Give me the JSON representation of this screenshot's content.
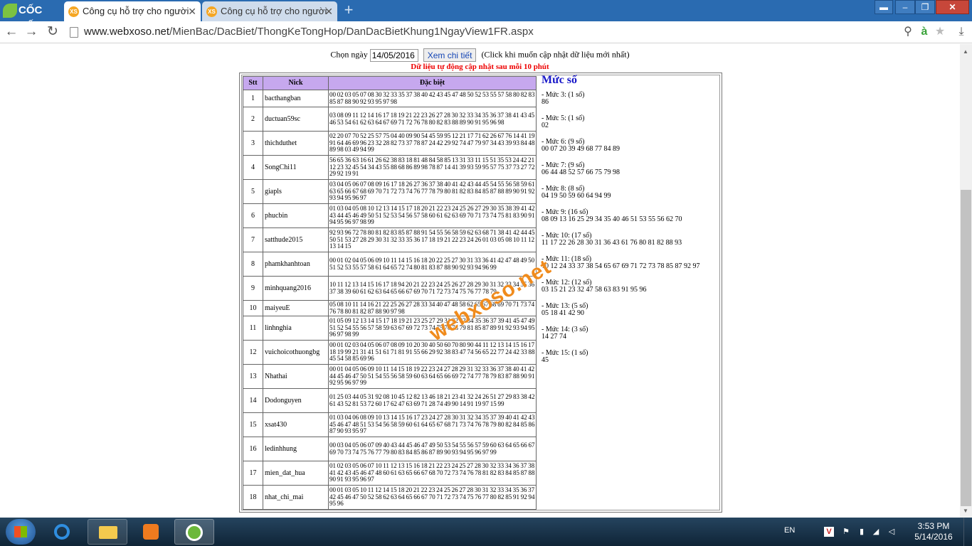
{
  "tabs": [
    {
      "title": "Công cụ hỗ trợ cho người",
      "favicon": "XS",
      "active": true
    },
    {
      "title": "Công cụ hỗ trợ cho người",
      "favicon": "XS",
      "active": false
    }
  ],
  "browser": {
    "logo": "CỐC CỐC",
    "url_domain": "www.webxoso.net",
    "url_path": "/MienBac/DacBiet/ThongKeTongHop/DanDacBietKhung1NgayView1FR.aspx"
  },
  "page": {
    "date_label": "Chọn ngày",
    "date_value": "14/05/2016",
    "button_label": "Xem chi tiết",
    "hint": "(Click khi muốn cập nhật dữ liệu mới nhất)",
    "auto_update": "Dữ liệu tự động cập nhật sau mỗi 10 phút",
    "headers": [
      "Stt",
      "Nick",
      "Đặc biệt"
    ],
    "rows": [
      {
        "stt": "1",
        "nick": "bacthangban",
        "db": "00 02 03 05 07 08 30 32 33 35 37 38 40 42 43 45 47 48 50 52 53 55 57 58 80 82 83 85 87 88 90 92 93 95 97 98"
      },
      {
        "stt": "2",
        "nick": "ductuan59sc",
        "db": "03 08 09 11 12 14 16 17 18 19 21 22 23 26 27 28 30 32 33 34 35 36 37 38 41 43 45 46 53 54 61 62 63 64 67 69 71 72 76 78 80 82 83 88 89 90 91 95 96 98"
      },
      {
        "stt": "3",
        "nick": "thichduthet",
        "db": "02 20 07 70 52 25 57 75 04 40 09 90 54 45 59 95 12 21 17 71 62 26 67 76 14 41 19 91 64 46 69 96 23 32 28 82 73 37 78 87 24 42 29 92 74 47 79 97 34 43 39 93 84 48 89 98 03 49 94 99"
      },
      {
        "stt": "4",
        "nick": "SongChi11",
        "db": "56 65 36 63 16 61 26 62 38 83 18 81 48 84 58 85 13 31 33 11 15 51 35 53 24 42 21 12 23 32 45 54 34 43 55 88 68 86 89 98 78 87 14 41 39 93 59 95 57 75 37 73 27 72 29 92 19 91"
      },
      {
        "stt": "5",
        "nick": "giapls",
        "db": "03 04 05 06 07 08 09 16 17 18 26 27 36 37 38 40 41 42 43 44 45 54 55 56 58 59 61 63 65 66 67 68 69 70 71 72 73 74 76 77 78 79 80 81 82 83 84 85 87 88 89 90 91 92 93 94 95 96 97"
      },
      {
        "stt": "6",
        "nick": "phucbin",
        "db": "01 03 04 05 08 10 12 13 14 15 17 18 20 21 22 23 24 25 26 27 29 30 35 38 39 41 42 43 44 45 46 49 50 51 52 53 54 56 57 58 60 61 62 63 69 70 71 73 74 75 81 83 90 91 94 95 96 97 98 99"
      },
      {
        "stt": "7",
        "nick": "satthude2015",
        "db": "92 93 96 72 78 80 81 82 83 85 87 88 91 54 55 56 58 59 62 63 68 71 38 41 42 44 45 50 51 53 27 28 29 30 31 32 33 35 36 17 18 19 21 22 23 24 26 01 03 05 08 10 11 12 13 14 15"
      },
      {
        "stt": "8",
        "nick": "phamkhanhtoan",
        "db": "00 01 02 04 05 06 09 10 11 14 15 16 18 20 22 25 27 30 31 33 36 41 42 47 48 49 50 51 52 53 55 57 58 61 64 65 72 74 80 81 83 87 88 90 92 93 94 96 99"
      },
      {
        "stt": "9",
        "nick": "minhquang2016",
        "db": "10 11 12 13 14 15 16 17 18 94 20 21 22 23 24 25 26 27 28 29 30 31 32 33 34 35 36 37 38 39 60 61 62 63 64 65 66 67 69 70 71 72 73 74 75 76 77 78 79"
      },
      {
        "stt": "10",
        "nick": "maiyeuE",
        "db": "05 08 10 11 14 16 21 22 25 26 27 28 33 34 40 47 48 58 62 65 67 68 69 70 71 73 74 76 78 80 81 82 87 88 90 97 98"
      },
      {
        "stt": "11",
        "nick": "linhnghia",
        "db": "01 05 09 12 13 14 15 17 18 19 21 23 25 27 29 31 32 33 34 35 36 37 39 41 45 47 49 51 52 54 55 56 57 58 59 63 67 69 72 73 74 75 76 78 79 81 85 87 89 91 92 93 94 95 96 97 98 99"
      },
      {
        "stt": "12",
        "nick": "vuichoicothuongbg",
        "db": "00 01 02 03 04 05 06 07 08 09 10 20 30 40 50 60 70 80 90 44 11 12 13 14 15 16 17 18 19 99 21 31 41 51 61 71 81 91 55 66 29 92 38 83 47 74 56 65 22 77 24 42 33 88 45 54 58 85 69 96"
      },
      {
        "stt": "13",
        "nick": "Nhathai",
        "db": "00 01 04 05 06 09 10 11 14 15 18 19 22 23 24 27 28 29 31 32 33 36 37 38 40 41 42 44 45 46 47 50 51 54 55 56 58 59 60 63 64 65 66 69 72 74 77 78 79 83 87 88 90 91 92 95 96 97 99"
      },
      {
        "stt": "14",
        "nick": "Dodonguyen",
        "db": "01 25 03 44 05 31 92 08 10 45 12 82 13 46 18 21 23 41 32 24 26 51 27 29 83 38 42 61 43 52 81 53 72 60 17 62 47 63 69 71 28 74 49 90 14 91 19 97 15 99"
      },
      {
        "stt": "15",
        "nick": "xsat430",
        "db": "01 03 04 06 08 09 10 13 14 15 16 17 23 24 27 28 30 31 32 34 35 37 39 40 41 42 43 45 46 47 48 51 53 54 56 58 59 60 61 64 65 67 68 71 73 74 76 78 79 80 82 84 85 86 87 90 93 95 97"
      },
      {
        "stt": "16",
        "nick": "ledinhhung",
        "db": "00 03 04 05 06 07 09 40 43 44 45 46 47 49 50 53 54 55 56 57 59 60 63 64 65 66 67 69 70 73 74 75 76 77 79 80 83 84 85 86 87 89 90 93 94 95 96 97 99"
      },
      {
        "stt": "17",
        "nick": "mien_dat_hua",
        "db": "01 02 03 05 06 07 10 11 12 13 15 16 18 21 22 23 24 25 27 28 30 32 33 34 36 37 38 41 42 43 45 46 47 48 60 61 63 65 66 67 68 70 72 73 74 76 78 81 82 83 84 85 87 88 90 91 93 95 96 97"
      },
      {
        "stt": "18",
        "nick": "nhat_chi_mai",
        "db": "00 01 03 05 10 11 12 14 15 18 20 21 22 23 24 25 26 27 28 30 31 32 33 34 35 36 37 42 45 46 47 50 52 58 62 63 64 65 66 67 70 71 72 73 74 75 76 77 80 82 85 91 92 94 95 96"
      }
    ],
    "muc_title": "Mức số",
    "muc": [
      {
        "label": "- Mức 3: (1 số)",
        "nums": "86"
      },
      {
        "label": "- Mức 5: (1 số)",
        "nums": "02"
      },
      {
        "label": "- Mức 6: (9 số)",
        "nums": "00 07 20 39 49 68 77 84 89"
      },
      {
        "label": "- Mức 7: (9 số)",
        "nums": "06 44 48 52 57 66 75 79 98"
      },
      {
        "label": "- Mức 8: (8 số)",
        "nums": "04 19 50 59 60 64 94 99"
      },
      {
        "label": "- Mức 9: (16 số)",
        "nums": "08 09 13 16 25 29 34 35 40 46 51 53 55 56 62 70"
      },
      {
        "label": "- Mức 10: (17 số)",
        "nums": "11 17 22 26 28 30 31 36 43 61 76 80 81 82 88 93"
      },
      {
        "label": "- Mức 11: (18 số)",
        "nums": "10 12 24 33 37 38 54 65 67 69 71 72 73 78 85 87 92 97"
      },
      {
        "label": "- Mức 12: (12 số)",
        "nums": "03 15 21 23 32 47 58 63 83 91 95 96"
      },
      {
        "label": "- Mức 13: (5 số)",
        "nums": "05 18 41 42 90"
      },
      {
        "label": "- Mức 14: (3 số)",
        "nums": "14 27 74"
      },
      {
        "label": "- Mức 15: (1 số)",
        "nums": "45"
      }
    ],
    "watermark": "webxoso.net"
  },
  "taskbar": {
    "lang": "EN",
    "time": "3:53 PM",
    "date": "5/14/2016"
  },
  "colors": {
    "titlebar": "#2a6bb1",
    "header_purple": "#c6a8ee",
    "alert_red": "#ee0000",
    "muc_blue": "#1717c8",
    "watermark": "#f08b1c"
  }
}
